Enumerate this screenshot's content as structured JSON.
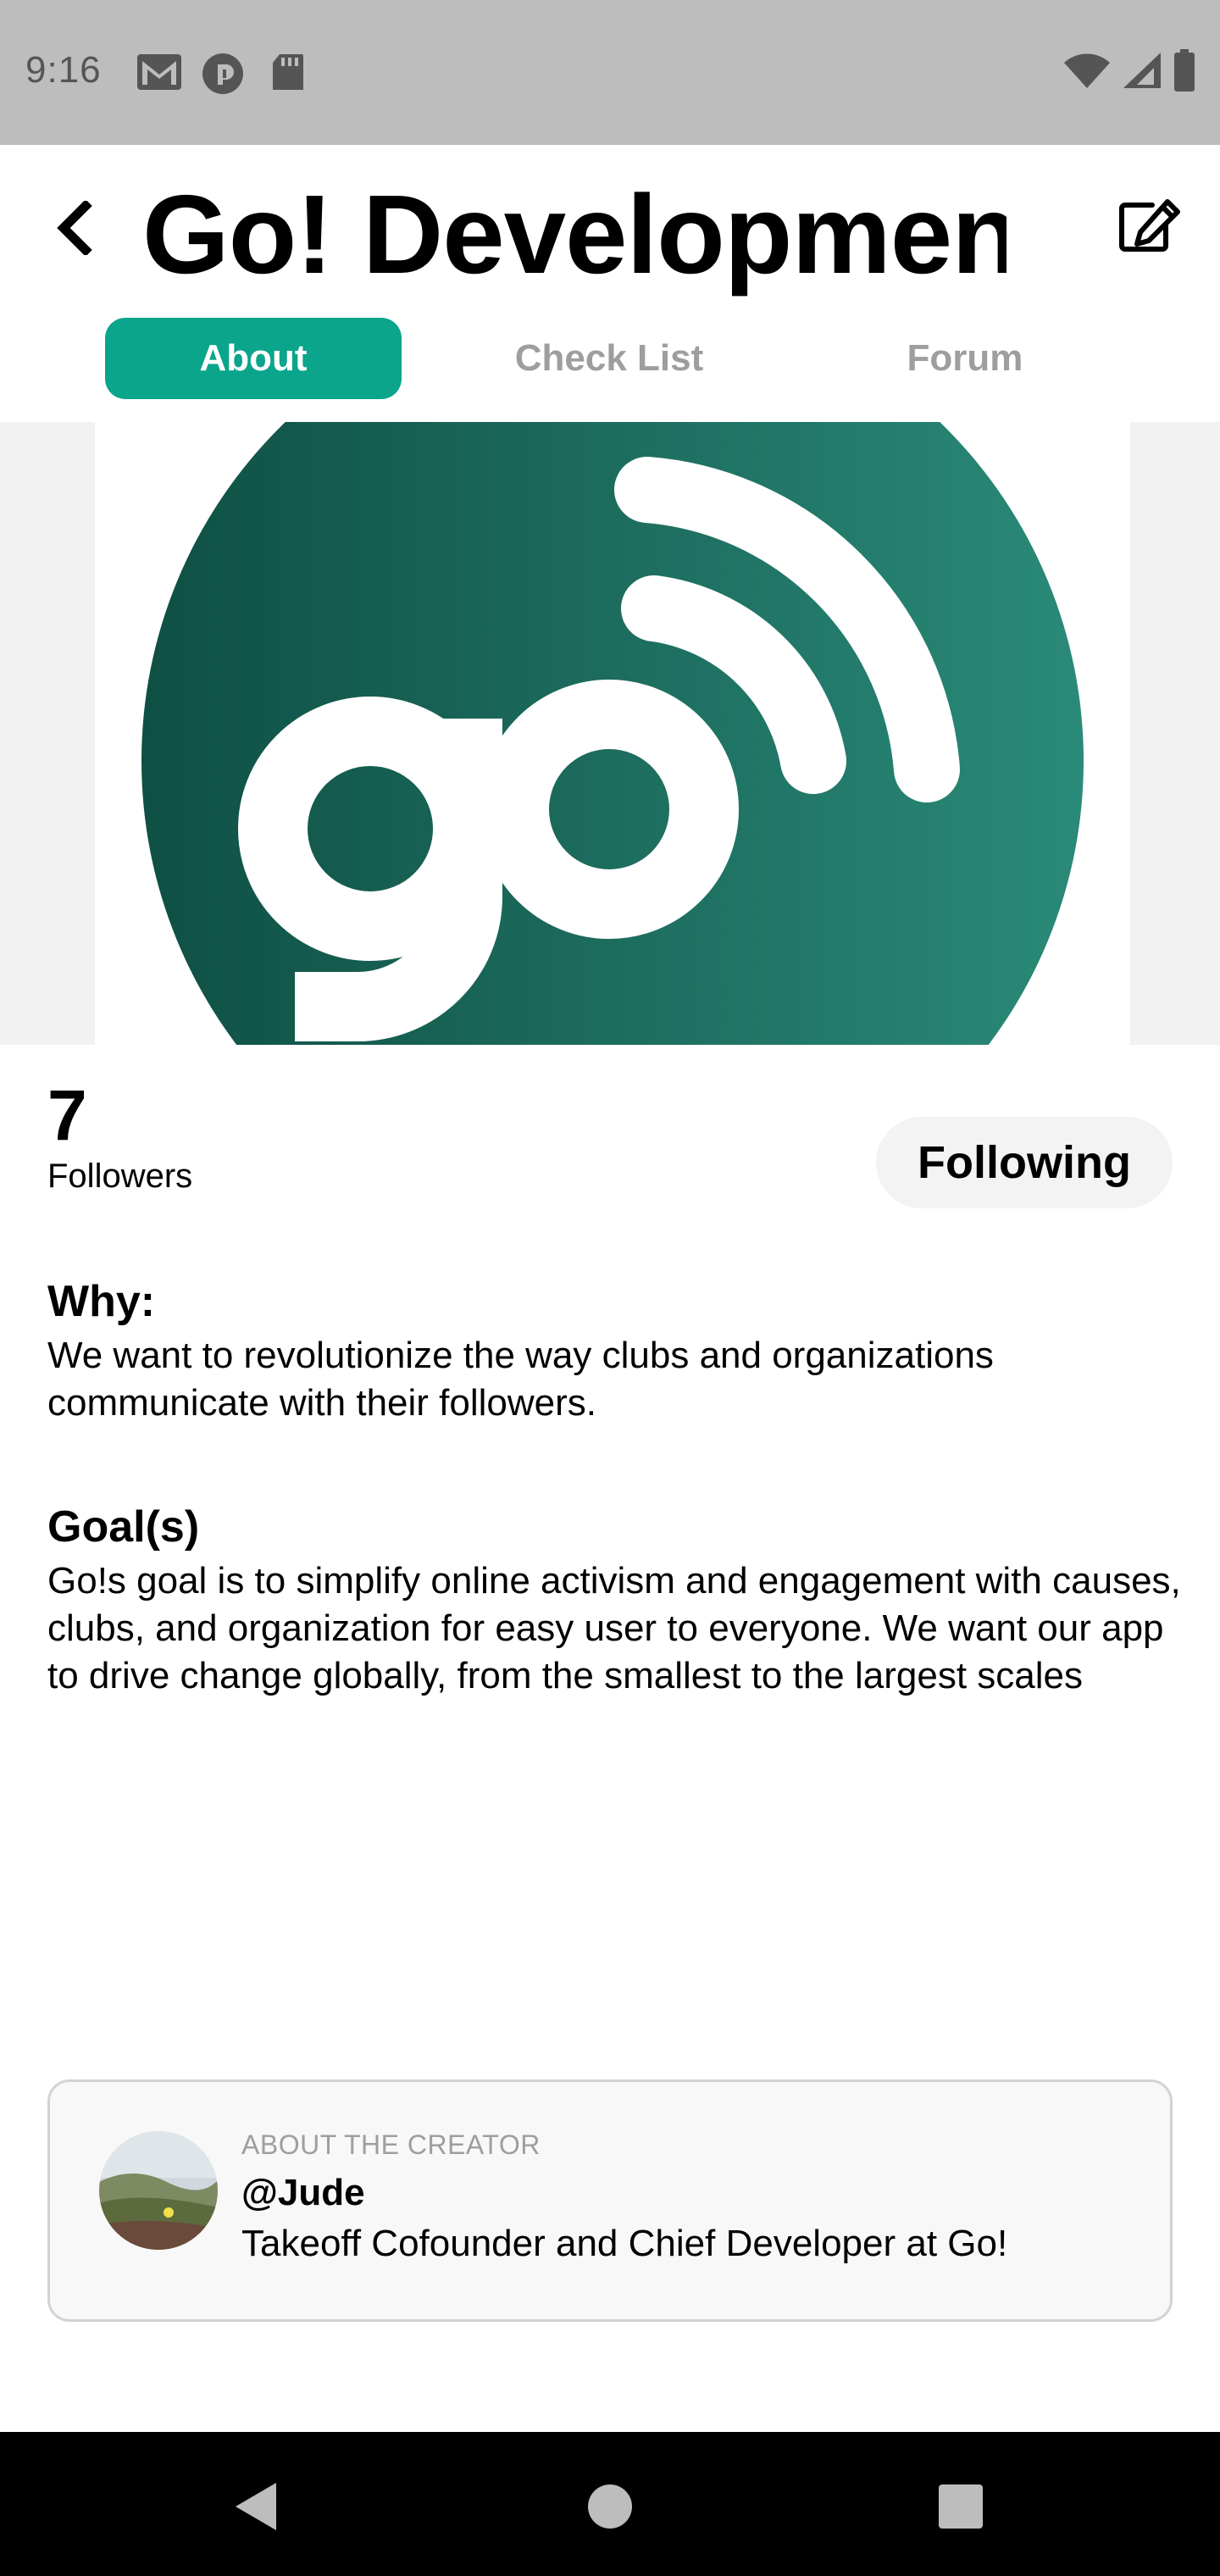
{
  "status_bar": {
    "time": "9:16",
    "left_icons": [
      "gmail-icon",
      "pocket-casts-icon",
      "sd-card-icon"
    ],
    "right_icons": [
      "wifi-icon",
      "signal-icon",
      "battery-icon"
    ]
  },
  "header": {
    "title": "Go! Development",
    "back_icon": "chevron-left-icon",
    "edit_icon": "edit-icon"
  },
  "tabs": [
    {
      "label": "About",
      "active": true
    },
    {
      "label": "Check List",
      "active": false
    },
    {
      "label": "Forum",
      "active": false
    }
  ],
  "hero": {
    "logo_text": "go",
    "colors": {
      "circle_dark": "#0f4f44",
      "circle_light": "#2a8a78",
      "glyph": "#ffffff"
    }
  },
  "stats": {
    "followers_count": "7",
    "followers_label": "Followers",
    "follow_button": "Following"
  },
  "why": {
    "heading": "Why:",
    "text": "We want to revolutionize the way clubs and organizations communicate with their followers."
  },
  "goals": {
    "heading": "Goal(s)",
    "text": "Go!s goal is to simplify online activism and engagement with causes, clubs, and organization for easy user to everyone. We want our app to drive change globally, from the smallest to the largest scales"
  },
  "creator": {
    "kicker": "ABOUT THE CREATOR",
    "handle": "@Jude",
    "bio": "Takeoff Cofounder and Chief Developer at Go!"
  },
  "nav_bar": {
    "icons": [
      "back-triangle-icon",
      "home-circle-icon",
      "recents-square-icon"
    ]
  },
  "colors": {
    "accent": "#0aa58a",
    "status_bar": "#bdbdbd",
    "nav_bar": "#000000"
  }
}
